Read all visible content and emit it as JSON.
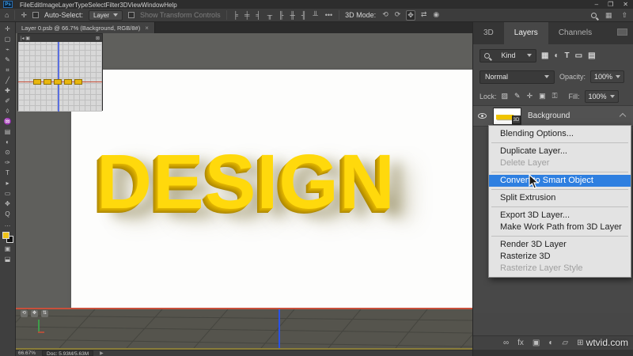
{
  "menubar": {
    "logo": "Ps",
    "items": [
      "File",
      "Edit",
      "Image",
      "Layer",
      "Type",
      "Select",
      "Filter",
      "3D",
      "View",
      "Window",
      "Help"
    ],
    "window_controls": {
      "minimize": "–",
      "restore": "❐",
      "close": "✕"
    }
  },
  "options_bar": {
    "home_icon": "⌂",
    "move_tool_icon": "✛",
    "auto_select_label": "Auto-Select:",
    "auto_select_value": "Layer",
    "show_transform_label": "Show Transform Controls",
    "align_icons": [
      "╞",
      "╪",
      "╡",
      "╥",
      "╟",
      "╫",
      "╢",
      "╨"
    ],
    "more_label": "•••",
    "mode_label": "3D Mode:",
    "mode_icons": [
      {
        "name": "orbit-3d-icon",
        "glyph": "⟲"
      },
      {
        "name": "roll-3d-icon",
        "glyph": "⟳"
      },
      {
        "name": "drag-3d-icon",
        "glyph": "✥",
        "state": "selected"
      },
      {
        "name": "slide-3d-icon",
        "glyph": "⇄"
      },
      {
        "name": "zoom-3d-icon",
        "glyph": "◉"
      }
    ]
  },
  "toolbar": {
    "tools": [
      {
        "name": "move-tool-icon",
        "glyph": "✛"
      },
      {
        "name": "marquee-tool-icon",
        "glyph": "▢"
      },
      {
        "name": "lasso-tool-icon",
        "glyph": "⌁"
      },
      {
        "name": "quick-select-tool-icon",
        "glyph": "✎"
      },
      {
        "name": "crop-tool-icon",
        "glyph": "⌗"
      },
      {
        "name": "eyedropper-tool-icon",
        "glyph": "╱"
      },
      {
        "name": "healing-tool-icon",
        "glyph": "✚"
      },
      {
        "name": "brush-tool-icon",
        "glyph": "✐"
      },
      {
        "name": "stamp-tool-icon",
        "glyph": "◊"
      },
      {
        "name": "history-brush-tool-icon",
        "glyph": "♒"
      },
      {
        "name": "eraser-tool-icon",
        "glyph": "▤"
      },
      {
        "name": "gradient-tool-icon",
        "glyph": "◐"
      },
      {
        "name": "dodge-tool-icon",
        "glyph": "⊙"
      },
      {
        "name": "pen-tool-icon",
        "glyph": "✑"
      },
      {
        "name": "type-tool-icon",
        "glyph": "T"
      },
      {
        "name": "path-select-tool-icon",
        "glyph": "▸"
      },
      {
        "name": "shape-tool-icon",
        "glyph": "▭"
      },
      {
        "name": "hand-tool-icon",
        "glyph": "✥"
      },
      {
        "name": "zoom-tool-icon",
        "glyph": "Q"
      },
      {
        "name": "more-tools-icon",
        "glyph": "…"
      }
    ],
    "foreground_color": "#f0c419",
    "background_color": "#111111",
    "bottom_icons": [
      {
        "name": "quick-mask-icon",
        "glyph": "▣"
      },
      {
        "name": "screen-mode-icon",
        "glyph": "⬓"
      }
    ]
  },
  "document": {
    "tab_title": "Layer 0.psb @ 66.7% (Background, RGB/8#)",
    "tab_close": "×"
  },
  "canvas": {
    "word": "DESIGN"
  },
  "mini_view": {
    "left_icons": "|◂ ▣",
    "right_icon": "⊠"
  },
  "nav_widgets": [
    "⟲",
    "✥",
    "⇅"
  ],
  "statusbar": {
    "zoom": "66.67%",
    "doc": "Doc: 5.93M/5.63M",
    "arrow": "▶"
  },
  "panel": {
    "tabs": [
      {
        "label": "3D"
      },
      {
        "label": "Layers",
        "state": "active"
      },
      {
        "label": "Channels"
      }
    ],
    "filter": {
      "kind_label": "Kind",
      "icons": [
        {
          "name": "filter-pixel-layers-icon",
          "glyph": "▦"
        },
        {
          "name": "filter-adjustment-layers-icon",
          "glyph": "◐"
        },
        {
          "name": "filter-type-layers-icon",
          "glyph": "T"
        },
        {
          "name": "filter-shape-layers-icon",
          "glyph": "▭"
        },
        {
          "name": "filter-smart-objects-icon",
          "glyph": "▤"
        }
      ]
    },
    "blend_mode": "Normal",
    "opacity_label": "Opacity:",
    "opacity_value": "100%",
    "lock_label": "Lock:",
    "lock_icons": [
      {
        "name": "lock-transparent-icon",
        "glyph": "▨"
      },
      {
        "name": "lock-pixels-icon",
        "glyph": "✎"
      },
      {
        "name": "lock-position-icon",
        "glyph": "✛"
      },
      {
        "name": "lock-artboard-icon",
        "glyph": "▣"
      },
      {
        "name": "lock-all-icon",
        "glyph": "⚿"
      }
    ],
    "fill_label": "Fill:",
    "fill_value": "100%",
    "layer_name": "Background",
    "layer_badge": "3D",
    "bottom_icons": [
      {
        "name": "link-layers-icon",
        "glyph": "∞"
      },
      {
        "name": "layer-effects-icon",
        "glyph": "fx"
      },
      {
        "name": "layer-mask-icon",
        "glyph": "▣"
      },
      {
        "name": "adjustment-layer-icon",
        "glyph": "◐"
      },
      {
        "name": "layer-group-icon",
        "glyph": "▱"
      },
      {
        "name": "new-layer-icon",
        "glyph": "⊞"
      }
    ]
  },
  "context_menu": {
    "items": [
      {
        "label": "Blending Options..."
      },
      {
        "label": "",
        "state": "sep"
      },
      {
        "label": "Duplicate Layer..."
      },
      {
        "label": "Delete Layer",
        "state": "disabled"
      },
      {
        "label": "",
        "state": "sep"
      },
      {
        "label": "Convert to Smart Object",
        "state": "highlighted"
      },
      {
        "label": "",
        "state": "sep"
      },
      {
        "label": "Split Extrusion"
      },
      {
        "label": "",
        "state": "sep"
      },
      {
        "label": "Export 3D Layer..."
      },
      {
        "label": "Make Work Path from 3D Layer"
      },
      {
        "label": "",
        "state": "sep"
      },
      {
        "label": "Render 3D Layer"
      },
      {
        "label": "Rasterize 3D"
      },
      {
        "label": "Rasterize Layer Style",
        "state": "disabled"
      }
    ]
  },
  "watermark": "wtvid.com",
  "colors": {
    "accent_blue": "#2e7fe0",
    "design_yellow": "#ffd90c",
    "axis_red": "#c8503b",
    "axis_blue": "#2a52e8",
    "ground_olive": "#8a7d3a"
  }
}
